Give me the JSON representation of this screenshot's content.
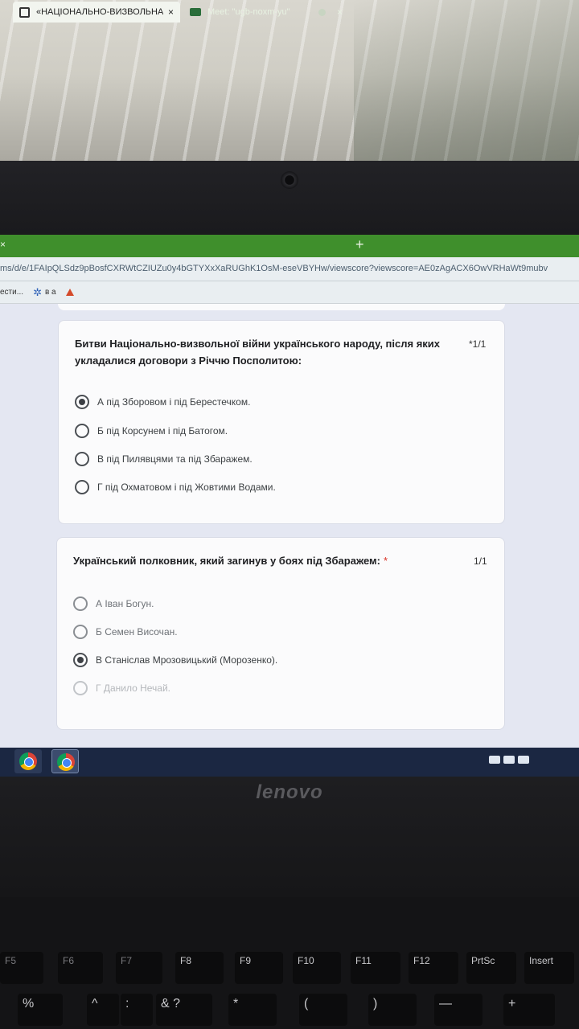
{
  "browser": {
    "tabs": [
      {
        "title": "«НАЦІОНАЛЬНО-ВИЗВОЛЬНА Е",
        "close": "×",
        "active": true
      },
      {
        "title": "Meet: \"ugb-noxm-yu\"",
        "close": "×",
        "active": false
      }
    ],
    "close_left": "×",
    "new_tab": "+",
    "url": "ms/d/e/1FAIpQLSdz9pBosfCXRWtCZIUZu0y4bGTYXxXaRUGhK1OsM-eseVBYHw/viewscore?viewscore=AE0zAgACX6OwVRHaWt9mubv",
    "bookmarks": [
      {
        "label": "ести..."
      },
      {
        "label": "в а"
      }
    ]
  },
  "questions": [
    {
      "text": "Битви Національно-визвольної війни українського народу, після яких укладалися договори з Річчю Посполитою:",
      "required": "*",
      "score": "1/1",
      "options": [
        {
          "label": "А під Зборовом і під Берестечком.",
          "selected": true
        },
        {
          "label": "Б під Корсунем і під Батогом.",
          "selected": false
        },
        {
          "label": "В під Пилявцями та під Збаражем.",
          "selected": false
        },
        {
          "label": "Г під Охматовом і під Жовтими Водами.",
          "selected": false
        }
      ]
    },
    {
      "text": "Український полковник, який загинув у боях під Збаражем:",
      "required": "*",
      "score": "1/1",
      "options": [
        {
          "label": "А Іван Богун.",
          "selected": false
        },
        {
          "label": "Б Семен Височан.",
          "selected": false
        },
        {
          "label": "В Станіслав Мрозовицький (Морозенко).",
          "selected": true
        },
        {
          "label": "Г Данило Нечай.",
          "selected": false
        }
      ]
    }
  ],
  "laptop": {
    "brand": "lenovo"
  },
  "keyboard": {
    "fkeys": [
      "F5",
      "F6",
      "F7",
      "F8",
      "F9",
      "F10",
      "F11",
      "F12",
      "PrtSc",
      "Insert"
    ],
    "symbols": [
      "%",
      "^",
      ":",
      "& ?",
      "*",
      "(",
      ")",
      "—",
      "+"
    ]
  },
  "colors": {
    "tabstrip": "#3f8f2c",
    "page_background": "#e4e7f2",
    "card": "#fbfbfc",
    "required_asterisk": "#d93025",
    "taskbar": "#1b2742"
  }
}
